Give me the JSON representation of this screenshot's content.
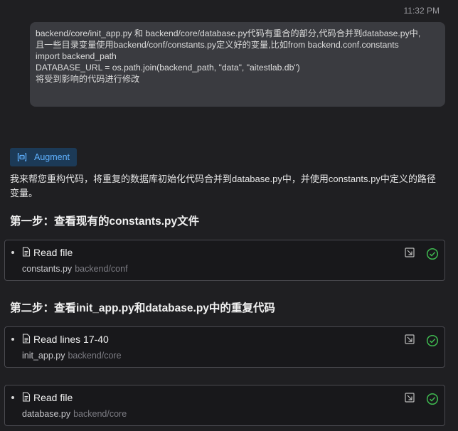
{
  "message": {
    "timestamp": "11:32 PM",
    "lines": [
      "backend/core/init_app.py 和  backend/core/database.py代码有重合的部分,代码合并到database.py中,",
      "且一些目录变量使用backend/conf/constants.py定义好的变量,比如from backend.conf.constants",
      "import backend_path",
      "DATABASE_URL = os.path.join(backend_path, \"data\", \"aitestlab.db\")",
      "将受到影响的代码进行修改"
    ]
  },
  "agent": {
    "name": "Augment",
    "icon": "augment-icon",
    "intro": "我来帮您重构代码，将重复的数据库初始化代码合并到database.py中，并使用constants.py中定义的路径变量。"
  },
  "steps": [
    {
      "heading": "第一步：查看现有的constants.py文件",
      "tools": [
        {
          "title": "Read file",
          "file": "constants.py",
          "dir": "backend/conf"
        }
      ]
    },
    {
      "heading": "第二步：查看init_app.py和database.py中的重复代码",
      "tools": [
        {
          "title": "Read lines 17-40",
          "file": "init_app.py",
          "dir": "backend/core"
        },
        {
          "title": "Read file",
          "file": "database.py",
          "dir": "backend/core"
        }
      ]
    }
  ],
  "colors": {
    "accent": "#5fb1ff",
    "success": "#3fb950",
    "background": "#1f1f22"
  },
  "icons": {
    "tool": "document-icon",
    "open": "open-external-icon",
    "status": "check-circle-icon"
  }
}
